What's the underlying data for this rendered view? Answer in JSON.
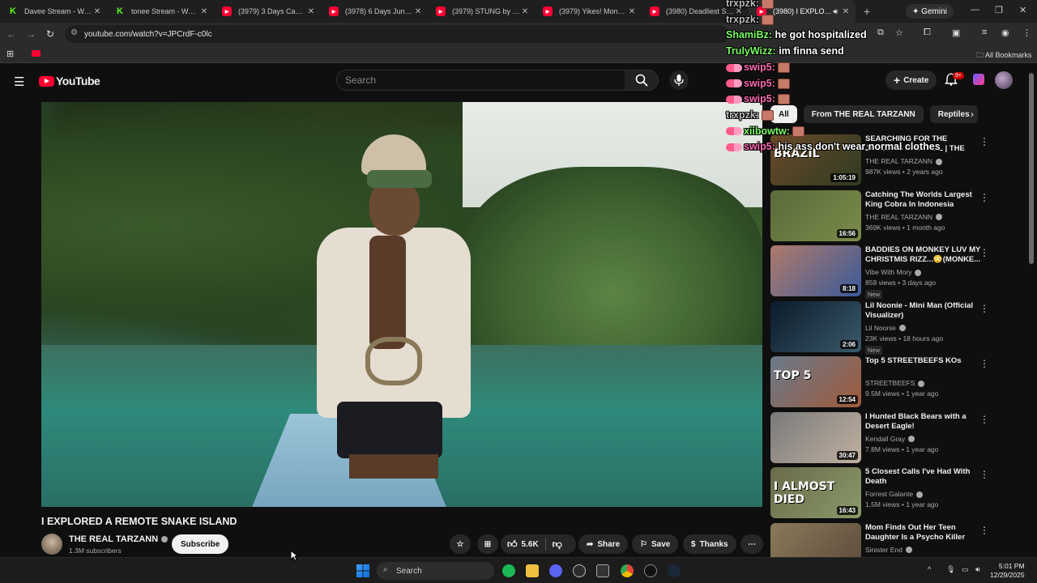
{
  "browser": {
    "tabs": [
      {
        "title": "Davee Stream - Watch L",
        "fav": "K",
        "type": "kick"
      },
      {
        "title": "tonee Stream - Watch L",
        "fav": "K",
        "type": "kick"
      },
      {
        "title": "(3979) 3 Days Camping",
        "fav": "▶",
        "type": "yt"
      },
      {
        "title": "(3978) 6 Days Jungle Su",
        "fav": "▶",
        "type": "yt"
      },
      {
        "title": "(3979) STUNG by a TAR",
        "fav": "▶",
        "type": "yt"
      },
      {
        "title": "(3979) Yikes! Monster W",
        "fav": "▶",
        "type": "yt"
      },
      {
        "title": "(3980) Deadliest Scorp",
        "fav": "▶",
        "type": "yt"
      },
      {
        "title": "(3980) I EXPLORED",
        "fav": "▶",
        "type": "yt",
        "active": true
      }
    ],
    "new_tab": "+",
    "gemini_label": "Gemini",
    "url": "youtube.com/watch?v=JPCrdF-c0lc",
    "all_bookmarks": "All Bookmarks"
  },
  "youtube": {
    "logo_text": "YouTube",
    "search_placeholder": "Search",
    "create_label": "Create",
    "notif_count": "9+"
  },
  "video": {
    "title": "I EXPLORED A REMOTE SNAKE ISLAND",
    "channel": "THE REAL TARZANN",
    "subscribers": "1.3M subscribers",
    "subscribe_label": "Subscribe",
    "likes": "5.6K",
    "share_label": "Share",
    "save_label": "Save",
    "thanks_label": "Thanks"
  },
  "chips": [
    "All",
    "From THE REAL TARZANN",
    "Reptiles"
  ],
  "recommendations": [
    {
      "title": "SEARCHING FOR THE JAGUARS IN BRAZIL | THE REAL ...",
      "channel": "THE REAL TARZANN",
      "meta": "987K views • 2 years ago",
      "duration": "1:05:19",
      "thumb_text": "BRAZIL",
      "colors": [
        "#6b4a2a",
        "#2f3a22"
      ]
    },
    {
      "title": "Catching The Worlds Largest King Cobra In Indonesia",
      "channel": "THE REAL TARZANN",
      "meta": "369K views • 1 month ago",
      "duration": "16:56",
      "thumb_text": "",
      "colors": [
        "#5b6a3a",
        "#7a8c4a"
      ]
    },
    {
      "title": "BADDIES ON MONKEY LUV MY CHRISTMIS RIZZ...😳(MONKE...",
      "channel": "Vibe With Mory",
      "meta": "858 views • 3 days ago",
      "duration": "8:18",
      "new": "New",
      "thumb_text": "",
      "colors": [
        "#b07a6a",
        "#3a5a9a"
      ]
    },
    {
      "title": "Lil Noonie - Mini Man (Official Visualizer)",
      "channel": "Lil Noonie",
      "meta": "23K views • 18 hours ago",
      "duration": "2:06",
      "new": "New",
      "thumb_text": "",
      "colors": [
        "#0b1a2a",
        "#3a5a6a"
      ]
    },
    {
      "title": "Top 5 STREETBEEFS KOs",
      "channel": "STREETBEEFS",
      "meta": "9.5M views • 1 year ago",
      "duration": "12:54",
      "thumb_text": "TOP 5",
      "colors": [
        "#6a7a8a",
        "#a05a3a"
      ]
    },
    {
      "title": "I Hunted Black Bears with a Desert Eagle!",
      "channel": "Kendall Gray",
      "meta": "7.8M views • 1 year ago",
      "duration": "30:47",
      "thumb_text": "",
      "colors": [
        "#7a7a7a",
        "#c0b0a0"
      ]
    },
    {
      "title": "5 Closest Calls I've Had With Death",
      "channel": "Forrest Galante",
      "meta": "1.5M views • 1 year ago",
      "duration": "16:43",
      "thumb_text": "I ALMOST DIED",
      "colors": [
        "#6a6a4a",
        "#8a9a6a"
      ]
    },
    {
      "title": "Mom Finds Out Her Teen Daughter Is a Psycho Killer",
      "channel": "Sinister End",
      "meta": "",
      "duration": "",
      "thumb_text": "",
      "colors": [
        "#8a7a5a",
        "#5a4a3a"
      ]
    }
  ],
  "chat": [
    {
      "user": "trxpzk:",
      "msg": "",
      "emote": true,
      "color": "gray",
      "badge": false
    },
    {
      "user": "trxpzk:",
      "msg": "",
      "emote": true,
      "color": "gray",
      "badge": false
    },
    {
      "user": "ShamiBz:",
      "msg": "he got hospitalized",
      "emote": false,
      "color": "green",
      "badge": false
    },
    {
      "user": "TrulyWizz:",
      "msg": "im finna send",
      "emote": false,
      "color": "green",
      "badge": false
    },
    {
      "user": "swip5:",
      "msg": "",
      "emote": true,
      "color": "pink",
      "badge": true
    },
    {
      "user": "swip5:",
      "msg": "",
      "emote": true,
      "color": "pink",
      "badge": true
    },
    {
      "user": "swip5:",
      "msg": "",
      "emote": true,
      "color": "pink",
      "badge": true
    },
    {
      "user": "trxpzk:",
      "msg": "",
      "emote": true,
      "color": "gray",
      "badge": false
    },
    {
      "user": "xiibowtw:",
      "msg": "",
      "emote": true,
      "color": "green",
      "badge": true
    },
    {
      "user": "swip5:",
      "msg": "his ass don't wear normal clothes",
      "emote": false,
      "color": "pink",
      "badge": true
    }
  ],
  "taskbar": {
    "search_label": "Search",
    "time": "5:01 PM",
    "date": "12/29/2025"
  }
}
